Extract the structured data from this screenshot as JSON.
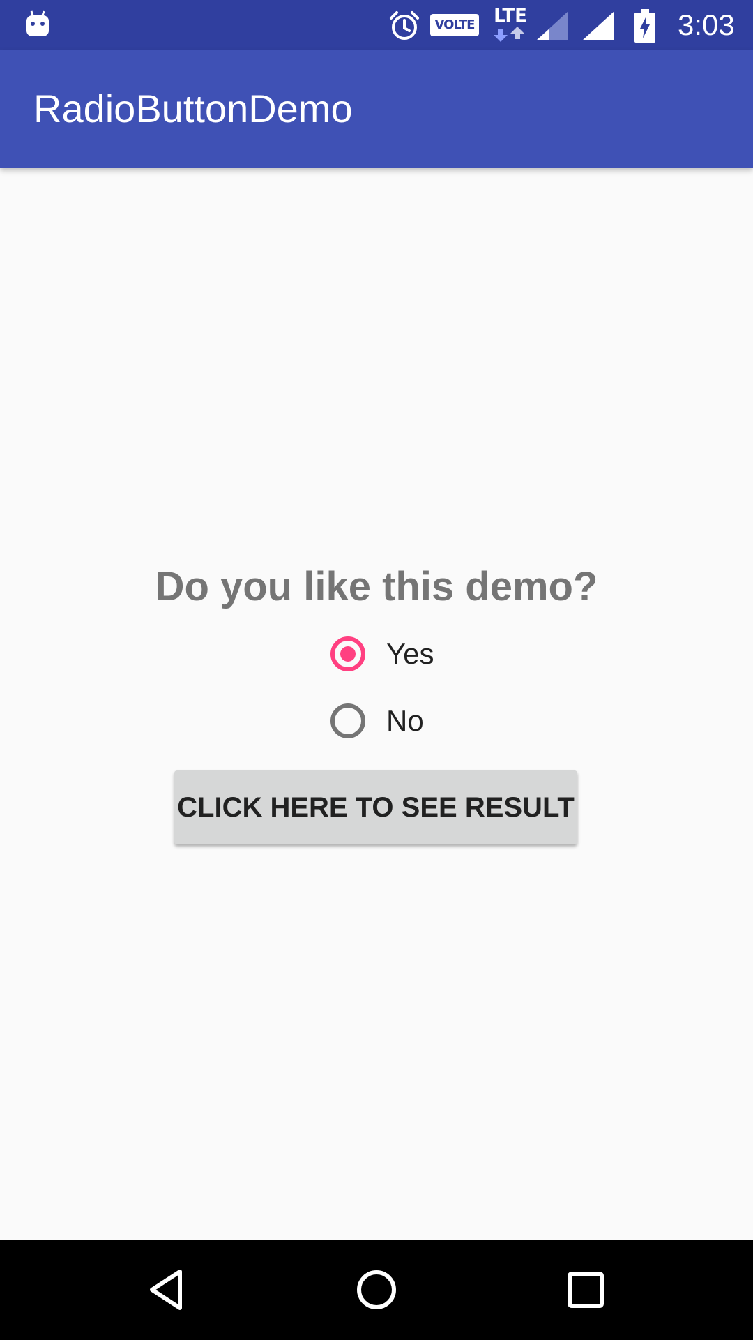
{
  "status_bar": {
    "time": "3:03",
    "volte_label": "VOLTE",
    "network_label": "LTE",
    "icons": [
      "android-icon",
      "alarm-icon",
      "volte-icon",
      "lte-icon",
      "signal-icon",
      "signal-icon",
      "battery-charging-icon"
    ]
  },
  "app_bar": {
    "title": "RadioButtonDemo"
  },
  "main": {
    "question": "Do you like this demo?",
    "options": [
      {
        "label": "Yes",
        "checked": true
      },
      {
        "label": "No",
        "checked": false
      }
    ],
    "button_label": "CLICK HERE TO SEE RESULT"
  },
  "nav_bar": {
    "icons": [
      "back-icon",
      "home-icon",
      "recents-icon"
    ]
  },
  "colors": {
    "status_bar": "#303f9f",
    "app_bar": "#3f51b5",
    "accent": "#ff4081",
    "background": "#fafafa",
    "button": "#d6d7d7"
  }
}
